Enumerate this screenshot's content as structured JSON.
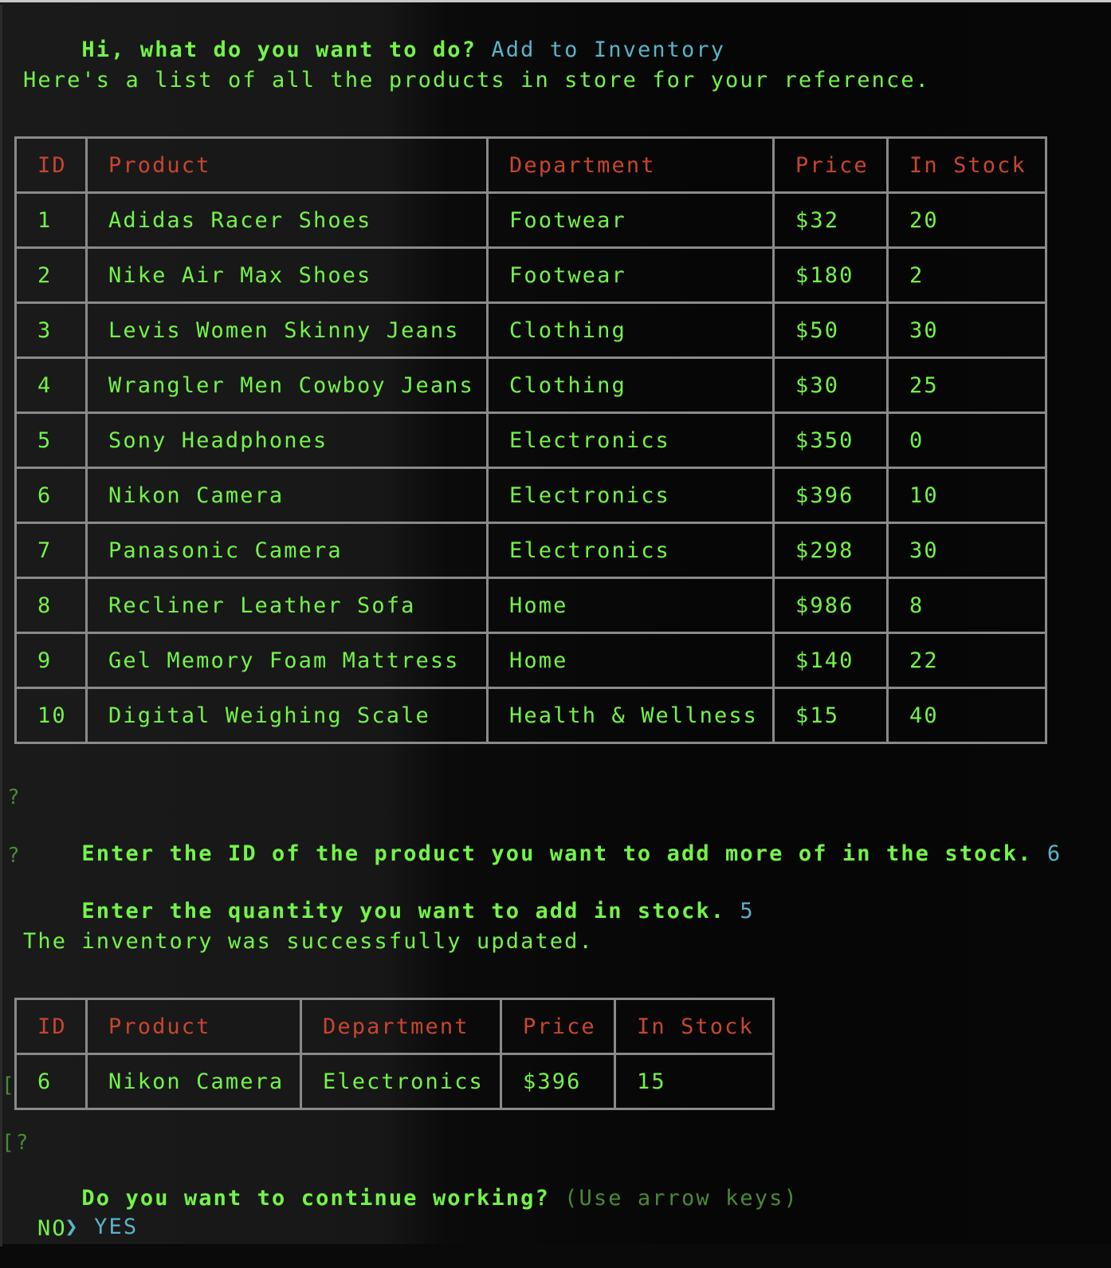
{
  "prompt_main": {
    "question": "Hi, what do you want to do?",
    "answer": "Add to Inventory"
  },
  "info_text": "Here's a list of all the products in store for your reference.",
  "products_table": {
    "headers": [
      "ID",
      "Product",
      "Department",
      "Price",
      "In Stock"
    ],
    "rows": [
      {
        "id": "1",
        "product": "Adidas Racer Shoes",
        "department": "Footwear",
        "price": "$32",
        "stock": "20"
      },
      {
        "id": "2",
        "product": "Nike Air Max Shoes",
        "department": "Footwear",
        "price": "$180",
        "stock": "2"
      },
      {
        "id": "3",
        "product": "Levis Women Skinny Jeans",
        "department": "Clothing",
        "price": "$50",
        "stock": "30"
      },
      {
        "id": "4",
        "product": "Wrangler Men Cowboy Jeans",
        "department": "Clothing",
        "price": "$30",
        "stock": "25"
      },
      {
        "id": "5",
        "product": "Sony Headphones",
        "department": "Electronics",
        "price": "$350",
        "stock": "0"
      },
      {
        "id": "6",
        "product": "Nikon Camera",
        "department": "Electronics",
        "price": "$396",
        "stock": "10"
      },
      {
        "id": "7",
        "product": "Panasonic Camera",
        "department": "Electronics",
        "price": "$298",
        "stock": "30"
      },
      {
        "id": "8",
        "product": "Recliner Leather Sofa",
        "department": "Home",
        "price": "$986",
        "stock": "8"
      },
      {
        "id": "9",
        "product": "Gel Memory Foam Mattress",
        "department": "Home",
        "price": "$140",
        "stock": "22"
      },
      {
        "id": "10",
        "product": "Digital Weighing Scale",
        "department": "Health & Wellness",
        "price": "$15",
        "stock": "40"
      }
    ]
  },
  "prompt_id": {
    "marker": "?",
    "question": "Enter the ID of the product you want to add more of in the stock.",
    "answer": "6"
  },
  "prompt_qty": {
    "marker": "?",
    "question": "Enter the quantity you want to add in stock.",
    "answer": "5"
  },
  "success_text": "The inventory was successfully updated.",
  "updated_table": {
    "headers": [
      "ID",
      "Product",
      "Department",
      "Price",
      "In Stock"
    ],
    "rows": [
      {
        "id": "6",
        "product": "Nikon Camera",
        "department": "Electronics",
        "price": "$396",
        "stock": "15"
      }
    ],
    "gutter_marker": "["
  },
  "prompt_continue": {
    "marker": "[?",
    "question": "Do you want to continue working?",
    "hint": "(Use arrow keys)",
    "pointer": "❯",
    "options": [
      "YES",
      "NO"
    ],
    "selected": "YES"
  },
  "colors": {
    "text_green": "#73f548",
    "answer_cyan": "#5ab3c8",
    "header_red": "#c9452f",
    "border_gray": "#8a8a8a",
    "hint_green": "#4a8a34"
  }
}
